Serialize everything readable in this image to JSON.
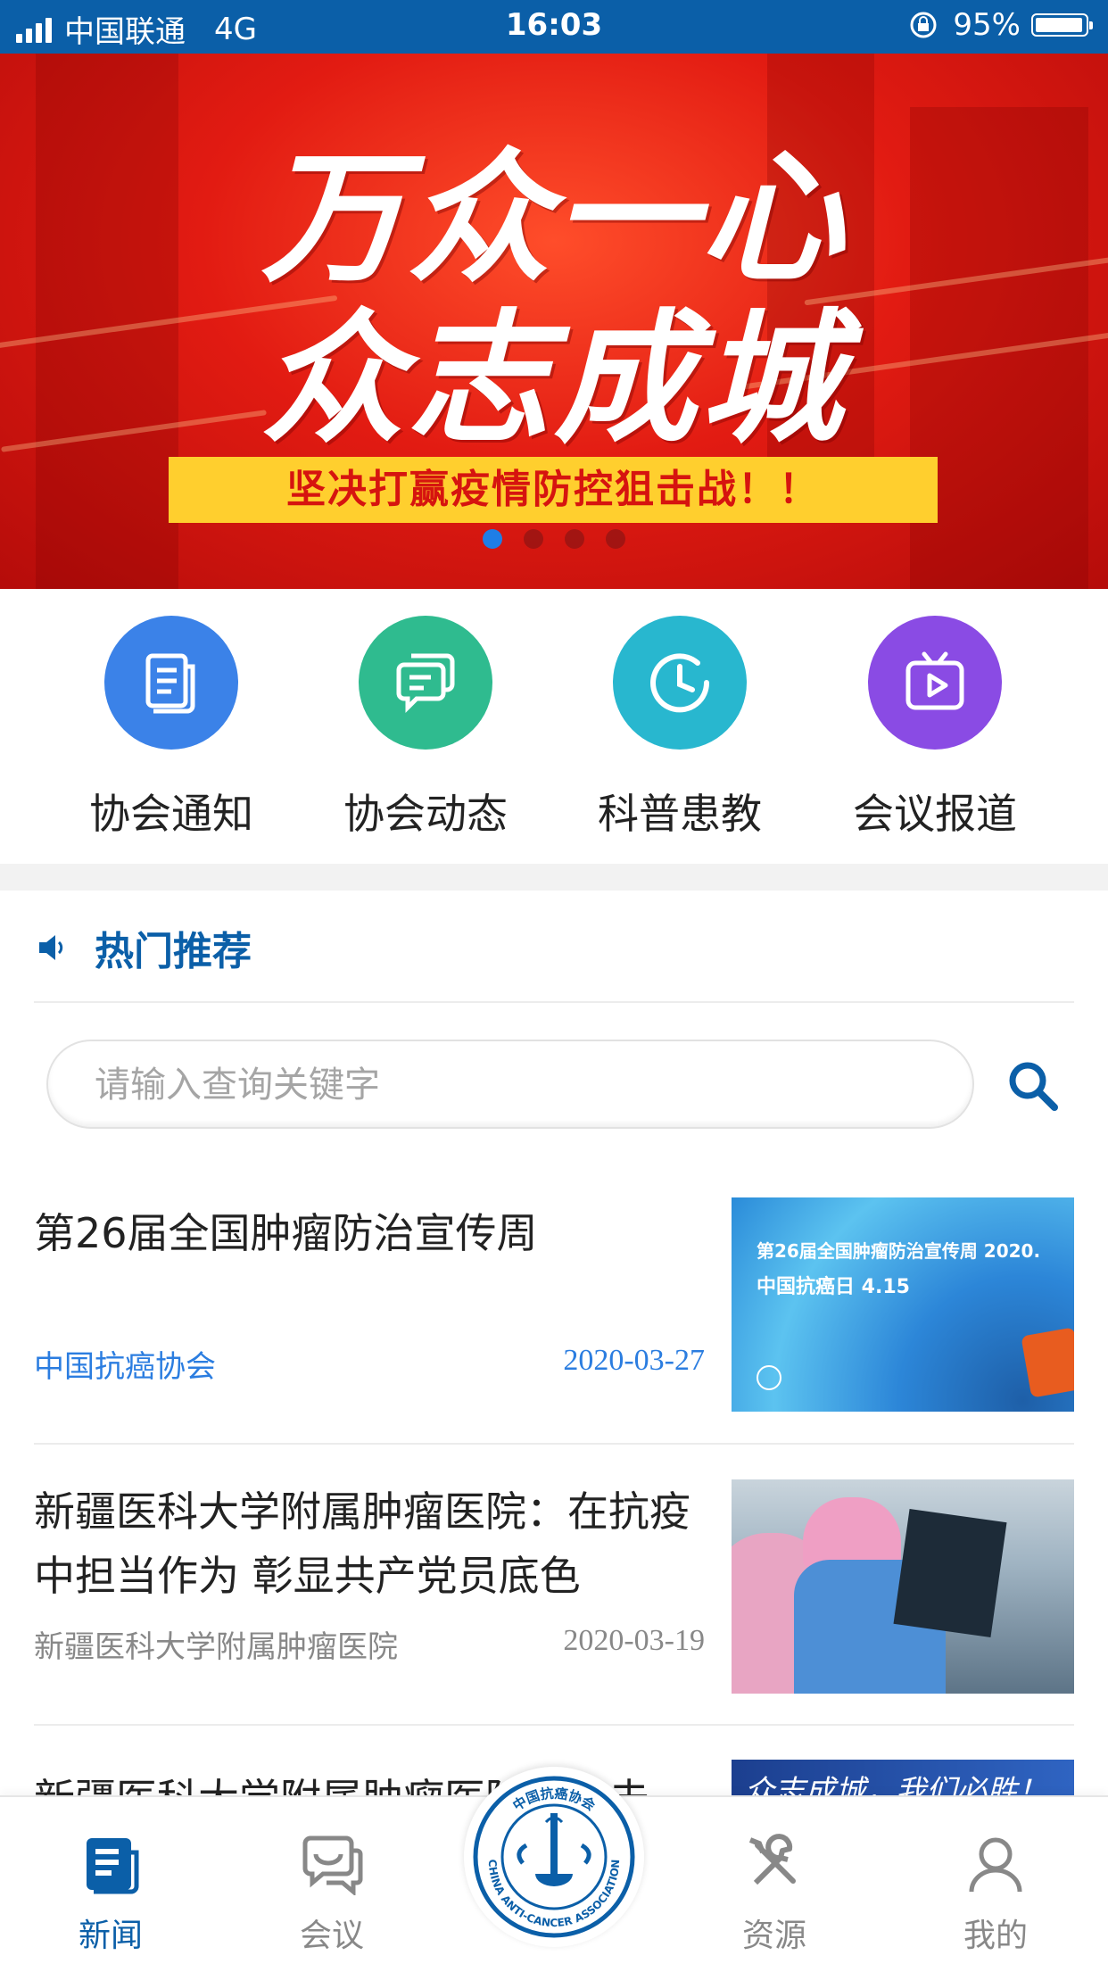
{
  "status_bar": {
    "carrier": "中国联通",
    "network": "4G",
    "time": "16:03",
    "battery": "95%"
  },
  "banner": {
    "line1": "万众一心",
    "line2": "众志成城",
    "slogan": "坚决打赢疫情防控狙击战！！",
    "page_count": 4,
    "active_page": 1
  },
  "quick_links": [
    {
      "label": "协会通知",
      "icon": "document-icon",
      "color": "#3b82e8"
    },
    {
      "label": "协会动态",
      "icon": "chat-icon",
      "color": "#2fbb8f"
    },
    {
      "label": "科普患教",
      "icon": "clock-icon",
      "color": "#28b7cf"
    },
    {
      "label": "会议报道",
      "icon": "tv-play-icon",
      "color": "#8a4be4"
    }
  ],
  "hot": {
    "title": "热门推荐",
    "icon": "speaker-icon"
  },
  "search": {
    "placeholder": "请输入查询关键字",
    "icon": "search-icon"
  },
  "news": [
    {
      "title": "第26届全国肿瘤防治宣传周",
      "source": "中国抗癌协会",
      "date": "2020-03-27",
      "thumb_line1": "第26届全国肿瘤防治宣传周 2020.",
      "thumb_line2": "中国抗癌日 4.15",
      "source_color": "#2b7de0",
      "date_color": "#2b7de0"
    },
    {
      "title": "新疆医科大学附属肿瘤医院：在抗疫中担当作为 彰显共产党员底色",
      "source": "新疆医科大学附属肿瘤医院",
      "date": "2020-03-19",
      "source_color": "#888888",
      "date_color": "#888888"
    },
    {
      "title": "新疆医科大学附属肿瘤医院：抗击",
      "thumb_text": "众志成城，我们必胜！"
    }
  ],
  "tabs": [
    {
      "label": "新闻",
      "icon": "news-icon",
      "active": true
    },
    {
      "label": "会议",
      "icon": "meeting-icon",
      "active": false
    },
    {
      "label": "资源",
      "icon": "tools-icon",
      "active": false
    },
    {
      "label": "我的",
      "icon": "user-icon",
      "active": false
    }
  ],
  "logo": {
    "text_top": "中国抗癌协会",
    "text_bottom": "CHINA ANTI-CANCER ASSOCIATION"
  }
}
